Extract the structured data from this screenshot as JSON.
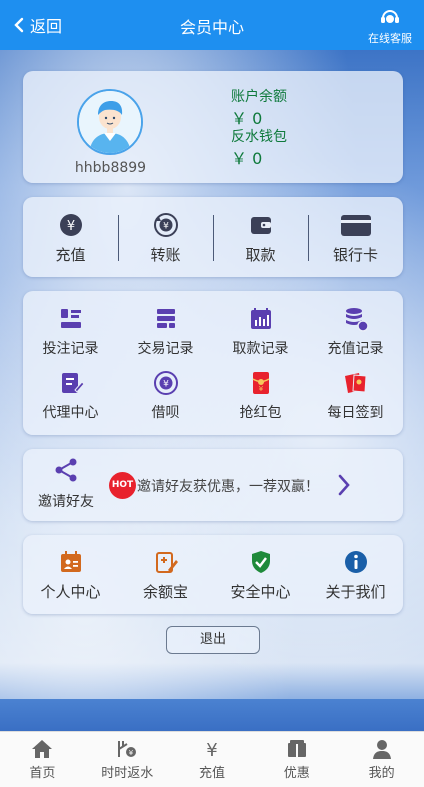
{
  "header": {
    "back_label": "返回",
    "title": "会员中心",
    "service_label": "在线客服"
  },
  "profile": {
    "username": "hhbb8899",
    "balance_label": "账户余额",
    "balance_value": "￥ 0",
    "rebate_label": "反水钱包",
    "rebate_value": "￥ 0"
  },
  "quick_actions": [
    {
      "label": "充值",
      "icon": "yen-coin-icon"
    },
    {
      "label": "转账",
      "icon": "transfer-icon"
    },
    {
      "label": "取款",
      "icon": "wallet-icon"
    },
    {
      "label": "银行卡",
      "icon": "bank-card-icon"
    }
  ],
  "records": [
    {
      "label": "投注记录",
      "icon": "bet-record-icon"
    },
    {
      "label": "交易记录",
      "icon": "transaction-record-icon"
    },
    {
      "label": "取款记录",
      "icon": "withdraw-record-icon"
    },
    {
      "label": "充值记录",
      "icon": "deposit-record-icon"
    },
    {
      "label": "代理中心",
      "icon": "agent-center-icon"
    },
    {
      "label": "借呗",
      "icon": "loan-icon"
    },
    {
      "label": "抢红包",
      "icon": "red-envelope-icon"
    },
    {
      "label": "每日签到",
      "icon": "daily-signin-icon"
    }
  ],
  "invite": {
    "label": "邀请好友",
    "hot_badge": "HOT",
    "promo_text": "邀请好友获优惠，一荐双赢！"
  },
  "personal": [
    {
      "label": "个人中心",
      "icon": "personal-center-icon"
    },
    {
      "label": "余额宝",
      "icon": "balance-treasure-icon"
    },
    {
      "label": "安全中心",
      "icon": "security-shield-icon"
    },
    {
      "label": "关于我们",
      "icon": "info-icon"
    }
  ],
  "logout_label": "退出",
  "tabbar": [
    {
      "label": "首页",
      "icon": "home-icon"
    },
    {
      "label": "时时返水",
      "icon": "rebate-icon"
    },
    {
      "label": "充值",
      "icon": "yen-icon"
    },
    {
      "label": "优惠",
      "icon": "promotion-icon"
    },
    {
      "label": "我的",
      "icon": "user-icon"
    }
  ],
  "colors": {
    "header_bg": "#1e8ff0",
    "balance_green": "#0f7a3c",
    "hot_red": "#e8222d",
    "record_purple": "#5a3fb0"
  }
}
